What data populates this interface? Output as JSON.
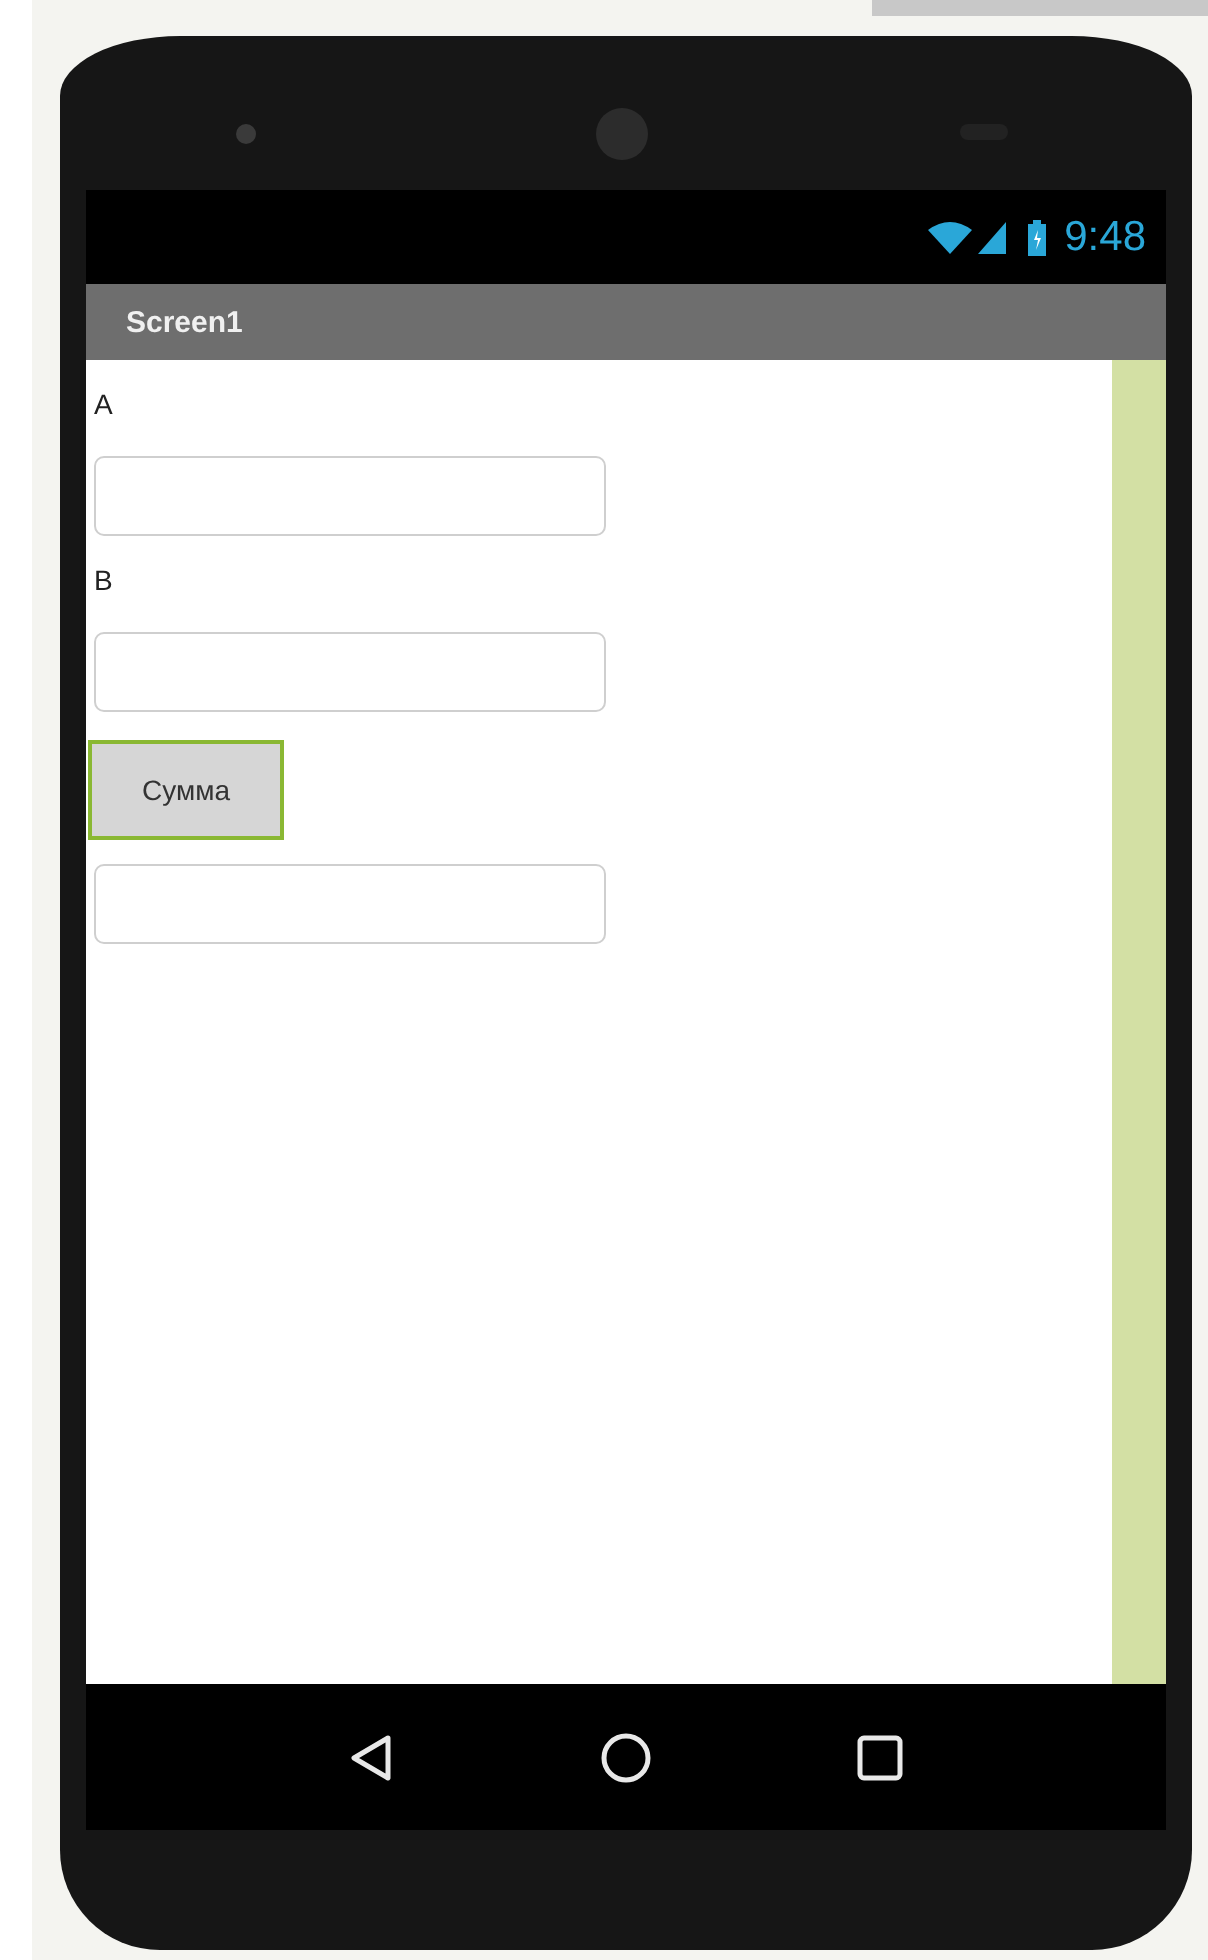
{
  "status_bar": {
    "time": "9:48"
  },
  "screen": {
    "title": "Screen1"
  },
  "components": [
    {
      "kind": "label",
      "text": "A",
      "selected": false
    },
    {
      "kind": "textbox",
      "selected": false
    },
    {
      "kind": "label",
      "text": "B",
      "selected": false
    },
    {
      "kind": "textbox",
      "selected": false
    },
    {
      "kind": "button",
      "text": "Сумма",
      "selected": true
    },
    {
      "kind": "textbox",
      "selected": false
    }
  ]
}
